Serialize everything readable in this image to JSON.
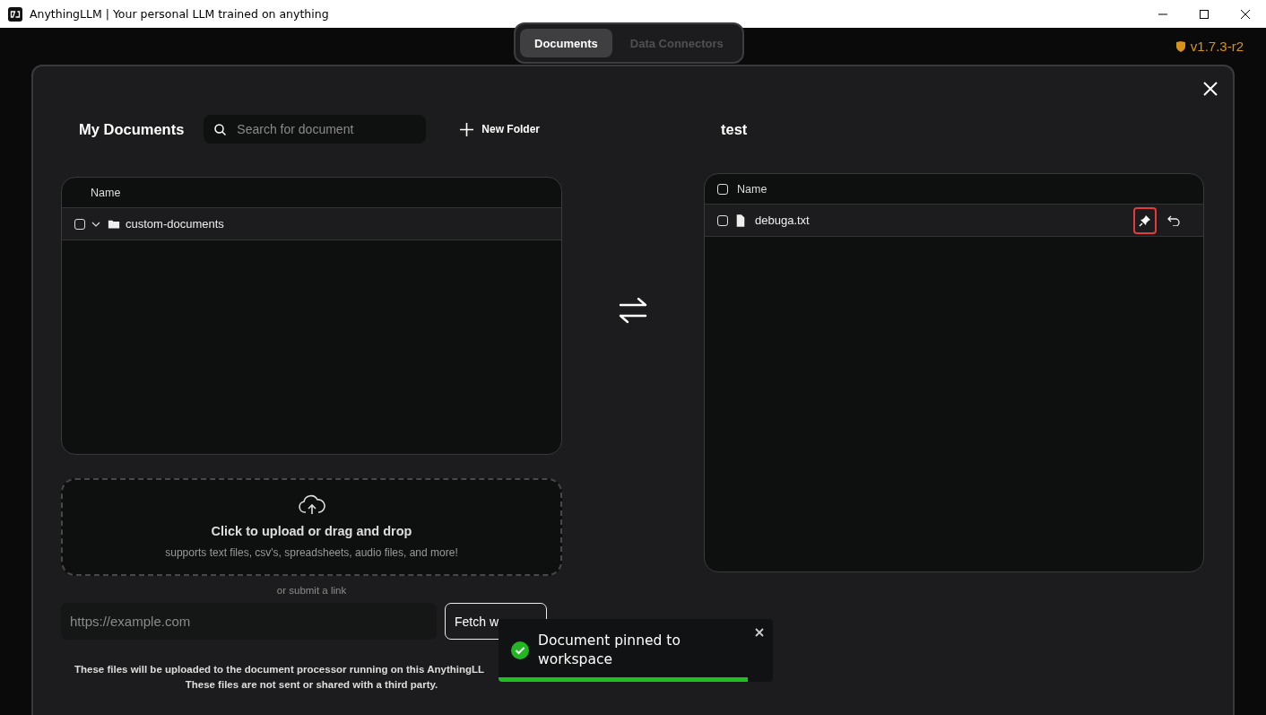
{
  "window": {
    "title": "AnythingLLM | Your personal LLM trained on anything"
  },
  "version": "v1.7.3-r2",
  "tabs": [
    {
      "label": "Documents",
      "selected": true
    },
    {
      "label": "Data Connectors",
      "selected": false
    }
  ],
  "my_documents": {
    "title": "My Documents",
    "search_placeholder": "Search for document",
    "new_folder": "New Folder",
    "columns": [
      "Name"
    ],
    "rows": [
      {
        "kind": "folder",
        "name": "custom-documents",
        "checked": false,
        "expanded": true
      }
    ]
  },
  "upload": {
    "title": "Click to upload or drag and drop",
    "subtitle": "supports text files, csv's, spreadsheets, audio files, and more!"
  },
  "link_label": "or submit a link",
  "url_placeholder": "https://example.com",
  "fetch_button": "Fetch w",
  "notice": [
    "These files will be uploaded to the document processor running on this AnythingLL",
    "These files are not sent or shared with a third party."
  ],
  "workspace": {
    "title": "test",
    "header_checked": false,
    "columns": [
      "Name"
    ],
    "rows": [
      {
        "kind": "file",
        "name": "debuga.txt",
        "checked": false,
        "pinned": true
      }
    ]
  },
  "toast": {
    "message": "Document pinned to workspace",
    "level": 0.91
  }
}
